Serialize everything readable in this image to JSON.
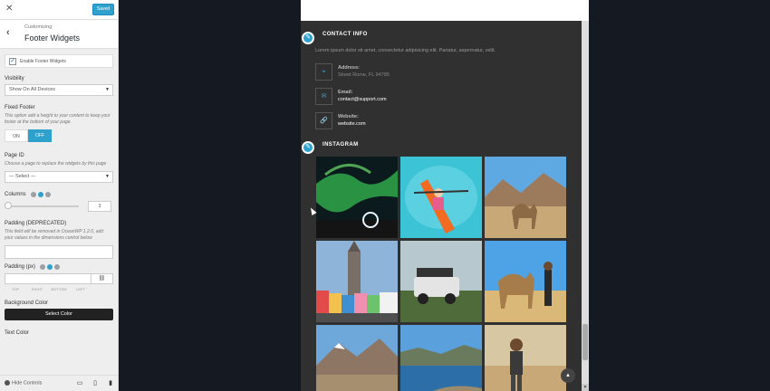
{
  "sidebar": {
    "close_icon": "✕",
    "publish_label": "Saved",
    "back_icon": "‹",
    "breadcrumb": "Customizing",
    "section_title": "Footer Widgets",
    "enable_label": "Enable Footer Widgets",
    "visibility": {
      "label": "Visibility",
      "value": "Show On All Devices"
    },
    "fixed_footer": {
      "label": "Fixed Footer",
      "desc": "This option add a height to your content to keep your footer at the bottom of your page.",
      "on_label": "ON",
      "off_label": "OFF"
    },
    "page_id": {
      "label": "Page ID",
      "desc": "Choose a page to replace the widgets by this page",
      "value": "— Select —"
    },
    "columns": {
      "label": "Columns",
      "value": "3"
    },
    "padding_deprecated": {
      "label": "Padding (DEPRECATED)",
      "desc": "This field will be removed in OceanWP 1.2.0, add your values in the dimensions control below"
    },
    "padding_px": {
      "label": "Padding (px)",
      "link_icon": "⛓",
      "sub_labels": [
        "TOP",
        "RIGHT",
        "BOTTOM",
        "LEFT"
      ]
    },
    "background_color": {
      "label": "Background Color",
      "button": "Select Color"
    },
    "text_color": {
      "label": "Text Color"
    },
    "hide_controls": "Hide Controls"
  },
  "preview": {
    "contact": {
      "title": "CONTACT INFO",
      "text": "Lorem ipsum dolor sit amet, consectetur adipisicing elit. Pariatur, aspernatur, velit.",
      "items": [
        {
          "icon": "⌖",
          "label": "Address:",
          "value": "Street Rome, FL 94785"
        },
        {
          "icon": "✉",
          "label": "Email:",
          "value": "contact@support.com"
        },
        {
          "icon": "🔗",
          "label": "Website:",
          "value": "website.com"
        }
      ]
    },
    "instagram": {
      "title": "INSTAGRAM"
    },
    "edit_icon": "✎",
    "back_to_top": "▲"
  }
}
